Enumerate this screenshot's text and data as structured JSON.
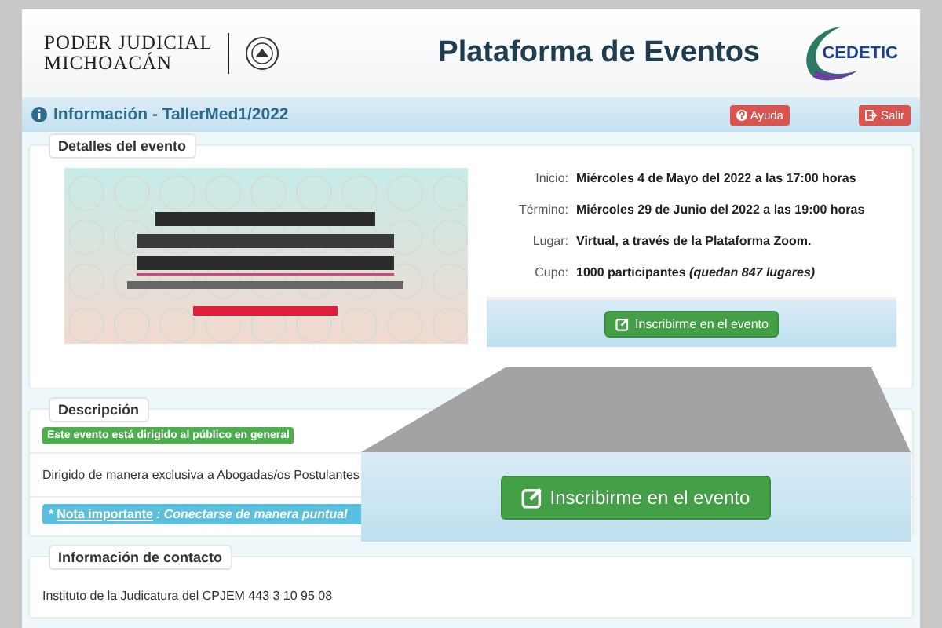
{
  "header": {
    "logo_lines": [
      "PODER JUDICIAL",
      "MICHOACÁN"
    ],
    "title": "Plataforma de Eventos",
    "logo_right": "CEDETIC"
  },
  "title_bar": {
    "title": "Información - TallerMed1/2022",
    "buttons": [
      {
        "label": "Ayuda",
        "kind": "help"
      },
      {
        "label": "Salir",
        "kind": "exit"
      }
    ]
  },
  "details": {
    "legend": "Detalles del evento",
    "rows": [
      {
        "label": "Inicio:",
        "value": "Miércoles 4 de Mayo del 2022 a las 17:00 horas"
      },
      {
        "label": "Término:",
        "value": "Miércoles 29 de Junio del 2022 a las 19:00 horas"
      },
      {
        "label": "Lugar:",
        "value": "Virtual, a través de la Plataforma Zoom."
      },
      {
        "label": "Cupo:",
        "value": "1000 participantes *(quedan 847 lugares)*"
      }
    ],
    "action": "Inscribirme en el evento"
  },
  "description": {
    "legend": "Descripción",
    "badge": "Este evento está dirigido al público en general",
    "text": "Dirigido de manera exclusiva a Abogadas/os Postulantes",
    "note": {
      "marker": "*",
      "link": "Nota importante",
      "text": ": Conectarse de manera puntual"
    }
  },
  "contact": {
    "legend": "Información de contacto",
    "text": "Instituto de la Judicatura del CPJEM 443 3 10 95 08"
  },
  "zoom_callout": {
    "action": "Inscribirme en el evento"
  }
}
